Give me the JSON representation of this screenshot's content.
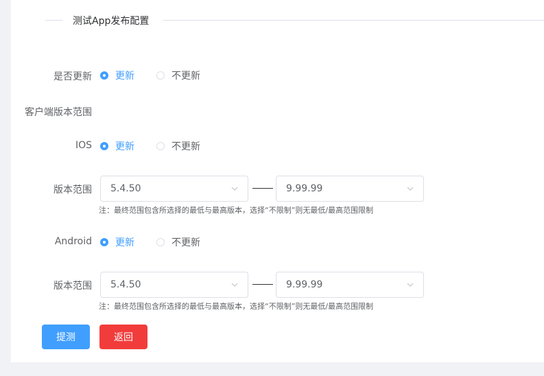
{
  "section": {
    "title": "测试App发布配置"
  },
  "update": {
    "label": "是否更新",
    "options": [
      "更新",
      "不更新"
    ],
    "selected": "更新"
  },
  "client_range": {
    "label": "客户端版本范围"
  },
  "ios": {
    "label": "IOS",
    "options": [
      "更新",
      "不更新"
    ],
    "selected": "更新",
    "version_label": "版本范围",
    "min_version": "5.4.50",
    "max_version": "9.99.99",
    "note": "注：最终范围包含所选择的最低与最高版本，选择“不限制”则无最低/最高范围限制"
  },
  "android": {
    "label": "Android",
    "options": [
      "更新",
      "不更新"
    ],
    "selected": "更新",
    "version_label": "版本范围",
    "min_version": "5.4.50",
    "max_version": "9.99.99",
    "note": "注：最终范围包含所选择的最低与最高版本，选择“不限制”则无最低/最高范围限制"
  },
  "buttons": {
    "submit": "提测",
    "back": "返回"
  },
  "colors": {
    "primary": "#409eff",
    "danger": "#f23c3c"
  }
}
